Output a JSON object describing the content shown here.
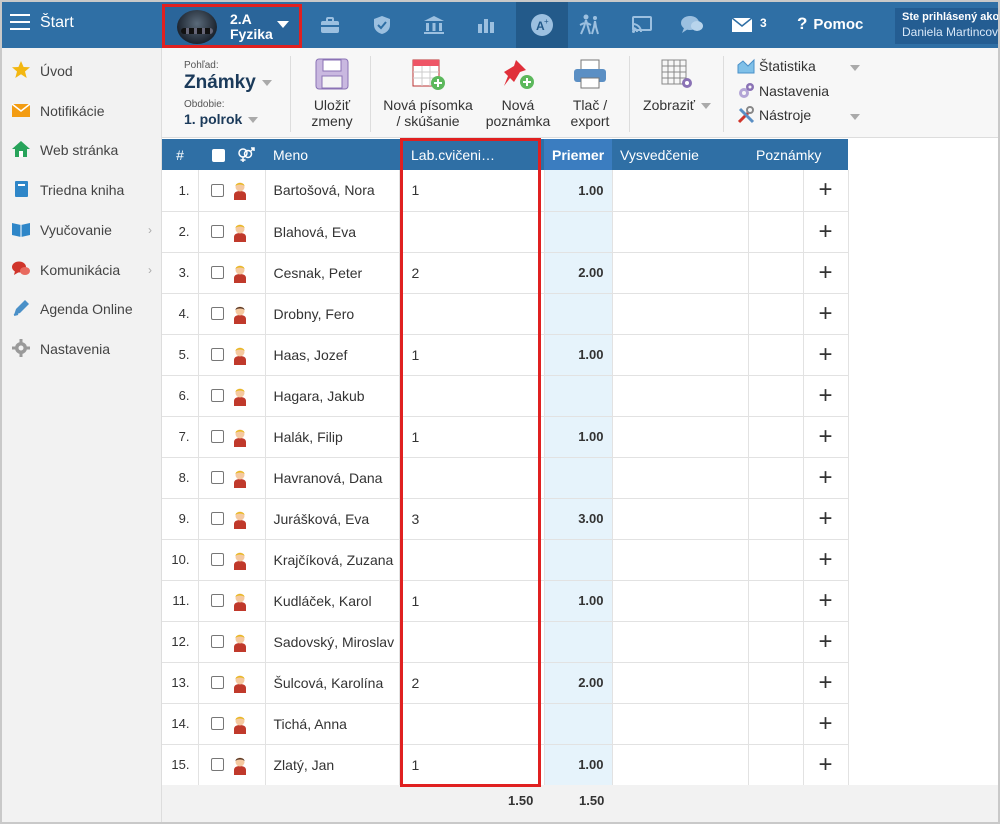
{
  "topbar": {
    "start_label": "Štart",
    "class_line1": "2.A",
    "class_line2": "Fyzika",
    "mail_count": "3",
    "help_label": "Pomoc",
    "user_line1": "Ste prihlásený ako",
    "user_line2": "Daniela Martincová"
  },
  "sidebar": {
    "items": [
      {
        "label": "Úvod",
        "icon": "star-icon"
      },
      {
        "label": "Notifikácie",
        "icon": "envelope-icon"
      },
      {
        "label": "Web stránka",
        "icon": "house-icon"
      },
      {
        "label": "Triedna kniha",
        "icon": "book-icon"
      },
      {
        "label": "Vyučovanie",
        "icon": "open-book-icon"
      },
      {
        "label": "Komunikácia",
        "icon": "chat-icon"
      },
      {
        "label": "Agenda Online",
        "icon": "pen-icon"
      },
      {
        "label": "Nastavenia",
        "icon": "gear-icon"
      }
    ]
  },
  "toolbar": {
    "view_label": "Pohľad:",
    "view_value": "Známky",
    "period_label": "Obdobie:",
    "period_value": "1. polrok",
    "save_label_1": "Uložiť",
    "save_label_2": "zmeny",
    "new_test_1": "Nová písomka",
    "new_test_2": "/ skúšanie",
    "new_note_1": "Nová",
    "new_note_2": "poznámka",
    "print_1": "Tlač /",
    "print_2": "export",
    "show_label": "Zobraziť",
    "stats_label": "Štatistika",
    "settings_label": "Nastavenia",
    "tools_label": "Nástroje"
  },
  "table": {
    "headers": {
      "num": "#",
      "name": "Meno",
      "lab": "Lab.cvičeni…",
      "avg": "Priemer",
      "report": "Vysvedčenie",
      "notes": "Poznámky"
    },
    "rows": [
      {
        "n": "1.",
        "name": "Bartošová, Nora",
        "grade": "1",
        "avg": "1.00",
        "gender": "f"
      },
      {
        "n": "2.",
        "name": "Blahová, Eva",
        "grade": "",
        "avg": "",
        "gender": "f"
      },
      {
        "n": "3.",
        "name": "Cesnak, Peter",
        "grade": "2",
        "avg": "2.00",
        "gender": "f"
      },
      {
        "n": "4.",
        "name": "Drobny, Fero",
        "grade": "",
        "avg": "",
        "gender": "m"
      },
      {
        "n": "5.",
        "name": "Haas, Jozef",
        "grade": "1",
        "avg": "1.00",
        "gender": "f"
      },
      {
        "n": "6.",
        "name": "Hagara, Jakub",
        "grade": "",
        "avg": "",
        "gender": "f"
      },
      {
        "n": "7.",
        "name": "Halák, Filip",
        "grade": "1",
        "avg": "1.00",
        "gender": "f"
      },
      {
        "n": "8.",
        "name": "Havranová, Dana",
        "grade": "",
        "avg": "",
        "gender": "f"
      },
      {
        "n": "9.",
        "name": "Jurášková, Eva",
        "grade": "3",
        "avg": "3.00",
        "gender": "f"
      },
      {
        "n": "10.",
        "name": "Krajčíková, Zuzana",
        "grade": "",
        "avg": "",
        "gender": "f"
      },
      {
        "n": "11.",
        "name": "Kudláček, Karol",
        "grade": "1",
        "avg": "1.00",
        "gender": "f"
      },
      {
        "n": "12.",
        "name": "Sadovský, Miroslav",
        "grade": "",
        "avg": "",
        "gender": "f"
      },
      {
        "n": "13.",
        "name": "Šulcová, Karolína",
        "grade": "2",
        "avg": "2.00",
        "gender": "f"
      },
      {
        "n": "14.",
        "name": "Tichá, Anna",
        "grade": "",
        "avg": "",
        "gender": "f"
      },
      {
        "n": "15.",
        "name": "Zlatý, Jan",
        "grade": "1",
        "avg": "1.00",
        "gender": "m"
      }
    ],
    "footer_lab_avg": "1.50",
    "footer_avg": "1.50"
  },
  "colors": {
    "accent": "#2f6fa5",
    "highlight": "#e02020",
    "avg_bg": "#e6f3fb"
  }
}
